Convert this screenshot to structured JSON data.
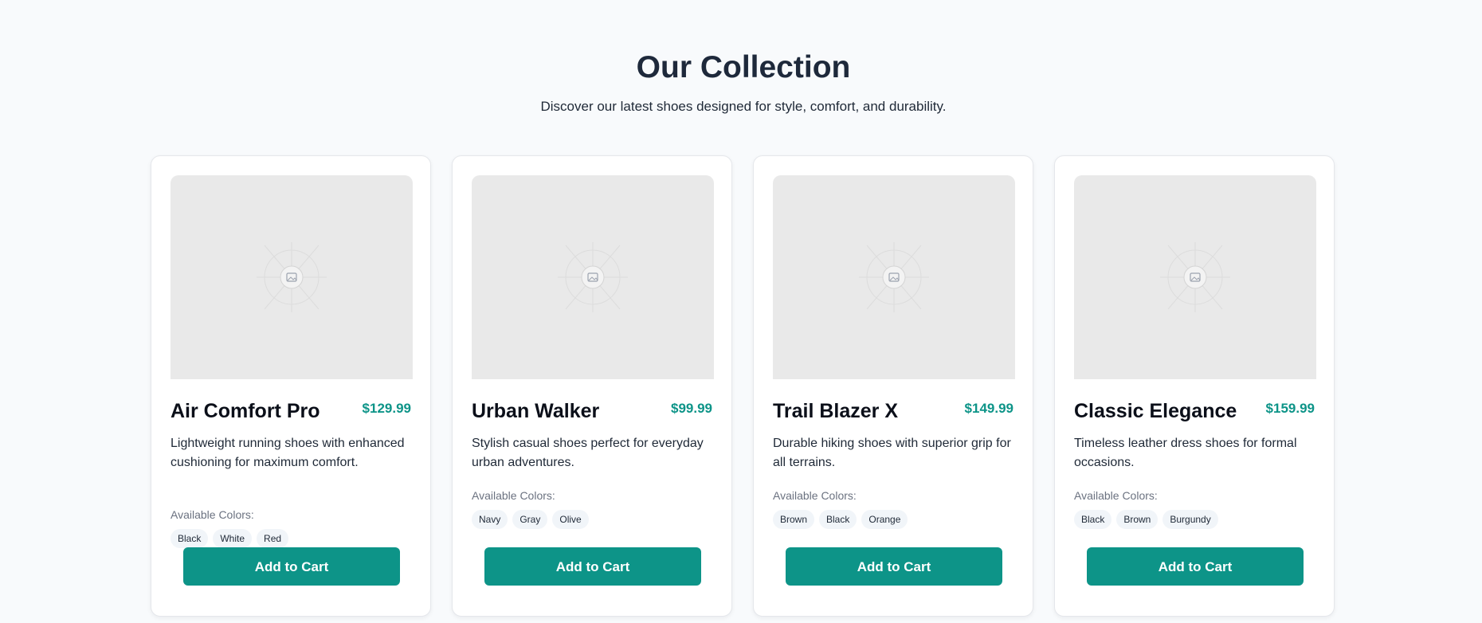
{
  "header": {
    "title": "Our Collection",
    "subtitle": "Discover our latest shoes designed for style, comfort, and durability."
  },
  "theme": {
    "accent": "#0d9488",
    "background": "#f8fafc",
    "placeholder": "#e9e9e9"
  },
  "products": [
    {
      "name": "Air Comfort Pro",
      "price": "$129.99",
      "description": "Lightweight running shoes with enhanced cushioning for maximum comfort.",
      "colors_label": "Available Colors:",
      "colors": [
        "Black",
        "White",
        "Red"
      ],
      "button_label": "Add to Cart",
      "image_icon": "image-placeholder-icon"
    },
    {
      "name": "Urban Walker",
      "price": "$99.99",
      "description": "Stylish casual shoes perfect for everyday urban adventures.",
      "colors_label": "Available Colors:",
      "colors": [
        "Navy",
        "Gray",
        "Olive"
      ],
      "button_label": "Add to Cart",
      "image_icon": "image-placeholder-icon"
    },
    {
      "name": "Trail Blazer X",
      "price": "$149.99",
      "description": "Durable hiking shoes with superior grip for all terrains.",
      "colors_label": "Available Colors:",
      "colors": [
        "Brown",
        "Black",
        "Orange"
      ],
      "button_label": "Add to Cart",
      "image_icon": "image-placeholder-icon"
    },
    {
      "name": "Classic Elegance",
      "price": "$159.99",
      "description": "Timeless leather dress shoes for formal occasions.",
      "colors_label": "Available Colors:",
      "colors": [
        "Black",
        "Brown",
        "Burgundy"
      ],
      "button_label": "Add to Cart",
      "image_icon": "image-placeholder-icon"
    }
  ]
}
